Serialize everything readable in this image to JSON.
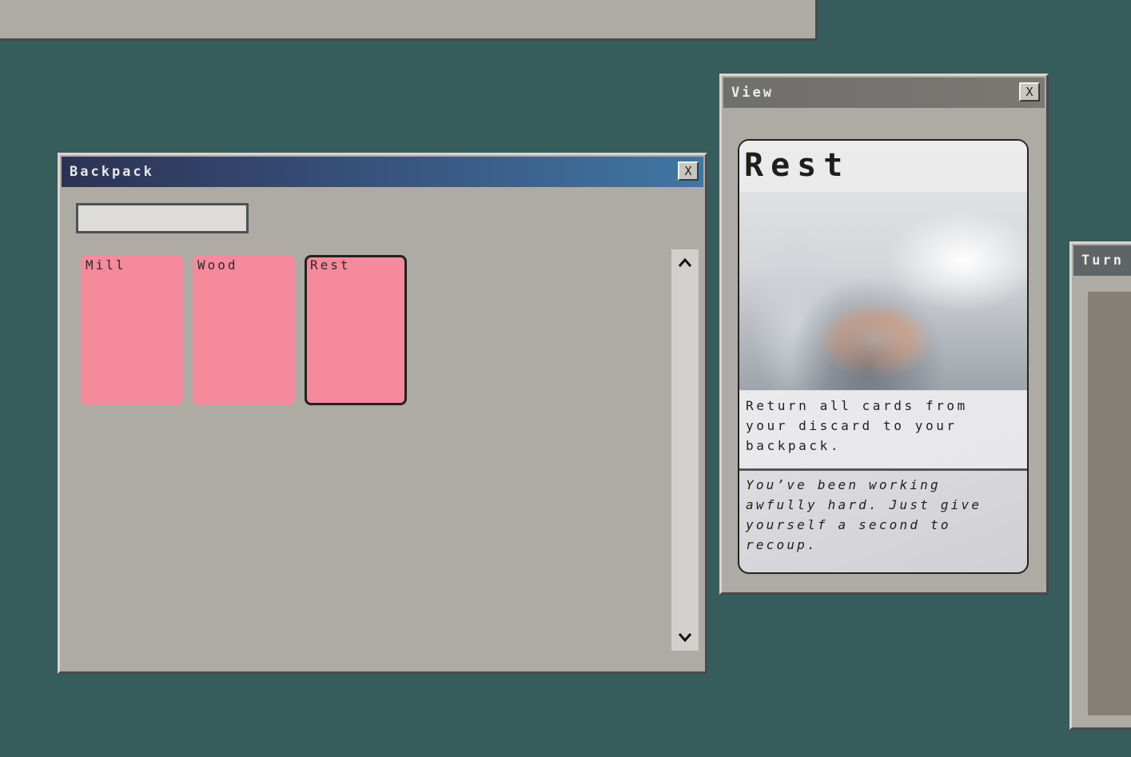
{
  "backpack": {
    "title": "Backpack",
    "close_label": "X",
    "search": {
      "value": "",
      "placeholder": ""
    },
    "cards": [
      {
        "label": "Mill",
        "selected": false
      },
      {
        "label": "Wood",
        "selected": false
      },
      {
        "label": "Rest",
        "selected": true
      }
    ],
    "card_color": "#f58a9c"
  },
  "view": {
    "title": "View",
    "close_label": "X",
    "card": {
      "title": "Rest",
      "description": "Return all cards from your discard to your backpack.",
      "flavor": "You’ve been working awfully hard. Just give yourself a second to recoup."
    }
  },
  "turn": {
    "title": "Turn"
  },
  "colors": {
    "desktop": "#365c5c",
    "window": "#aeaaa4",
    "backpack_titlebar_start": "#2c3254",
    "backpack_titlebar_end": "#3f77a3"
  }
}
